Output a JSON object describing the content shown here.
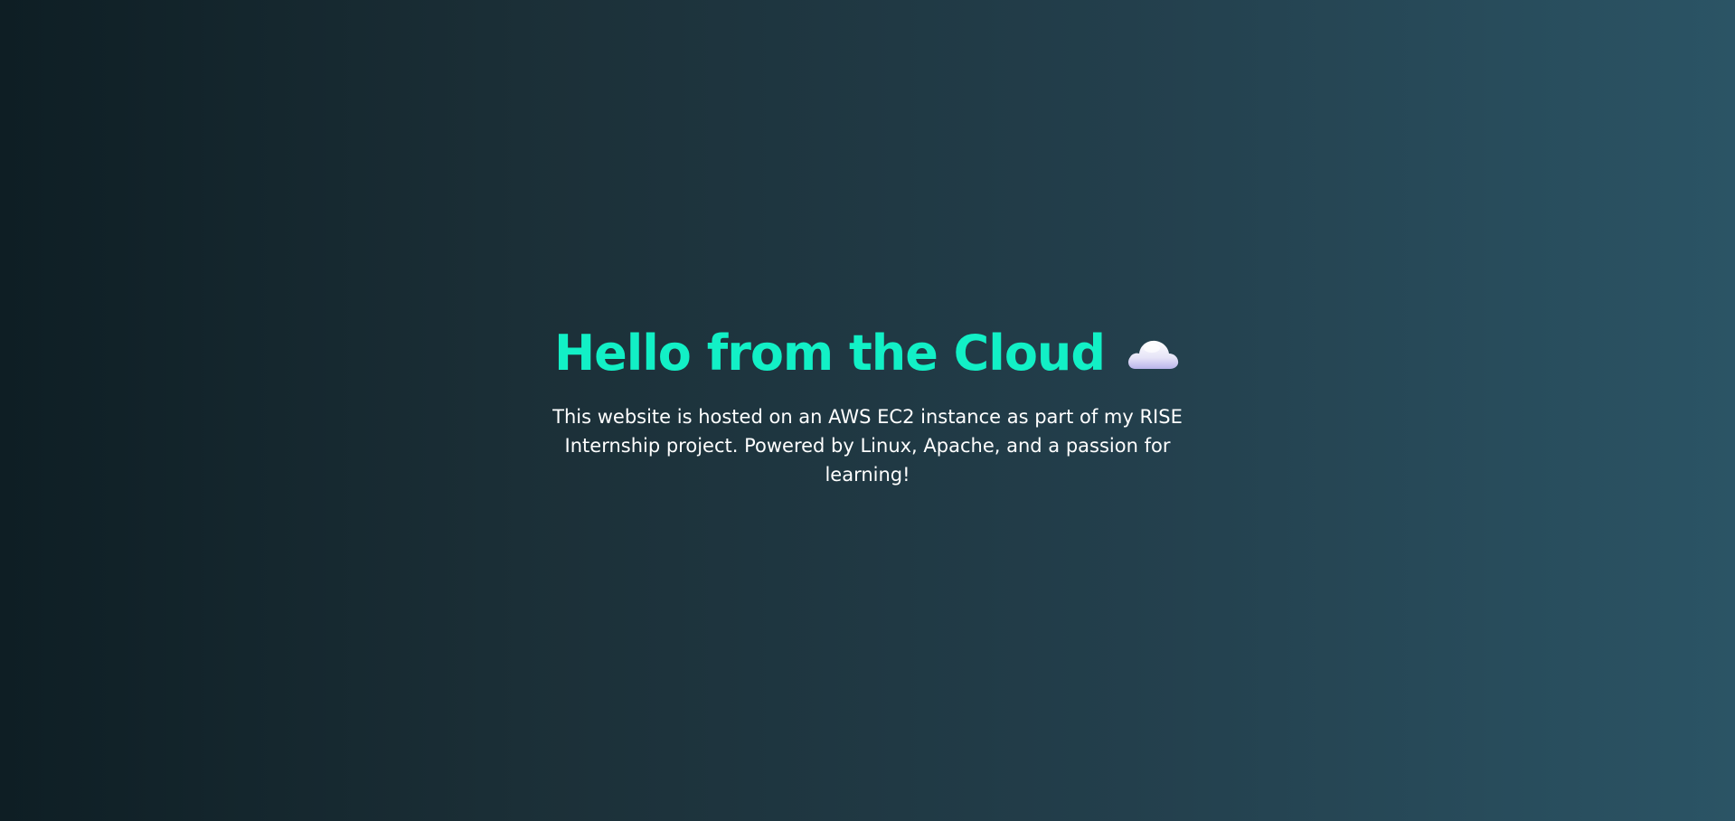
{
  "hero": {
    "title": "Hello from the Cloud",
    "title_icon": "cloud-icon",
    "description": "This website is hosted on an AWS EC2 instance as part of my RISE Internship project. Powered by Linux, Apache, and a passion for learning!"
  },
  "colors": {
    "title": "#12f0c6",
    "text": "#ffffff",
    "background_start": "#0e1e24",
    "background_end": "#2b5465"
  }
}
